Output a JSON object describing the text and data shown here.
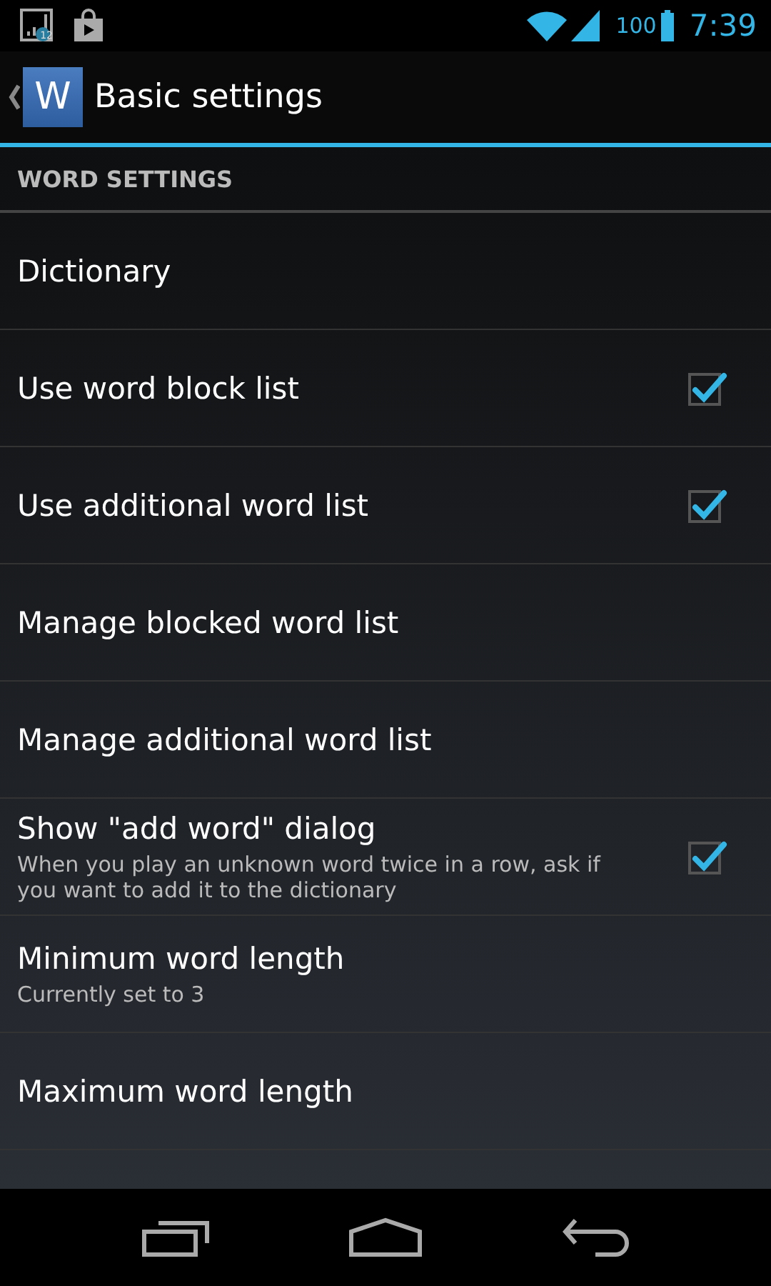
{
  "status_bar": {
    "notification_badge": "12",
    "battery_text": "100",
    "time": "7:39"
  },
  "action_bar": {
    "app_letter": "W",
    "title": "Basic settings"
  },
  "section": {
    "title": "WORD SETTINGS"
  },
  "items": [
    {
      "kind": "link",
      "title": "Dictionary"
    },
    {
      "kind": "checkbox",
      "title": "Use word block list",
      "checked": true
    },
    {
      "kind": "checkbox",
      "title": "Use additional word list",
      "checked": true
    },
    {
      "kind": "link",
      "title": "Manage blocked word list"
    },
    {
      "kind": "link",
      "title": "Manage additional word list"
    },
    {
      "kind": "checkbox",
      "title": "Show \"add word\" dialog",
      "summary": "When you play an unknown word twice in a row, ask if you want to add it to the dictionary",
      "checked": true
    },
    {
      "kind": "link",
      "title": "Minimum word length",
      "summary": "Currently set to 3"
    },
    {
      "kind": "link",
      "title": "Maximum word length"
    }
  ]
}
